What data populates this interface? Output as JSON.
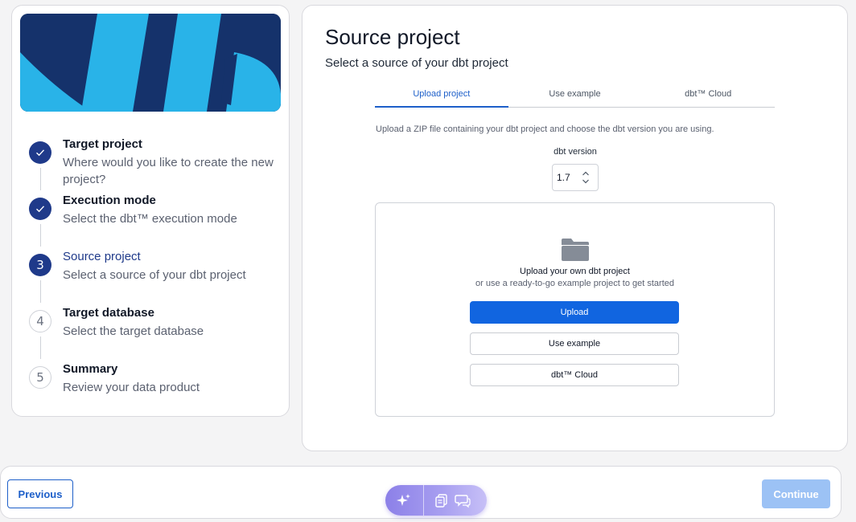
{
  "steps": [
    {
      "number": "1",
      "title": "Target project",
      "description": "Where would you like to create the new project?",
      "state": "done"
    },
    {
      "number": "2",
      "title": "Execution mode",
      "description": "Select the dbt™ execution mode",
      "state": "done"
    },
    {
      "number": "3",
      "title": "Source project",
      "description": "Select a source of your dbt project",
      "state": "current"
    },
    {
      "number": "4",
      "title": "Target database",
      "description": "Select the target database",
      "state": "pending"
    },
    {
      "number": "5",
      "title": "Summary",
      "description": "Review your data product",
      "state": "pending"
    }
  ],
  "main": {
    "title": "Source project",
    "subtitle": "Select a source of your dbt project",
    "tabs": [
      {
        "label": "Upload project",
        "active": true
      },
      {
        "label": "Use example",
        "active": false
      },
      {
        "label": "dbt™ Cloud",
        "active": false
      }
    ],
    "hint": "Upload a ZIP file containing your dbt project and choose the dbt version you are using.",
    "version": {
      "label": "dbt version",
      "value": "1.7"
    },
    "dropzone": {
      "title": "Upload your own dbt project",
      "subtitle": "or use a ready-to-go example project to get started",
      "upload_label": "Upload",
      "example_label": "Use example",
      "cloud_label": "dbt™ Cloud"
    }
  },
  "footer": {
    "previous_label": "Previous",
    "continue_label": "Continue"
  },
  "colors": {
    "primary": "#1165e0",
    "step_active": "#1f3a8a",
    "banner_dark": "#15326b",
    "banner_light": "#29b3e8",
    "continue_disabled": "#9cc2f5"
  }
}
